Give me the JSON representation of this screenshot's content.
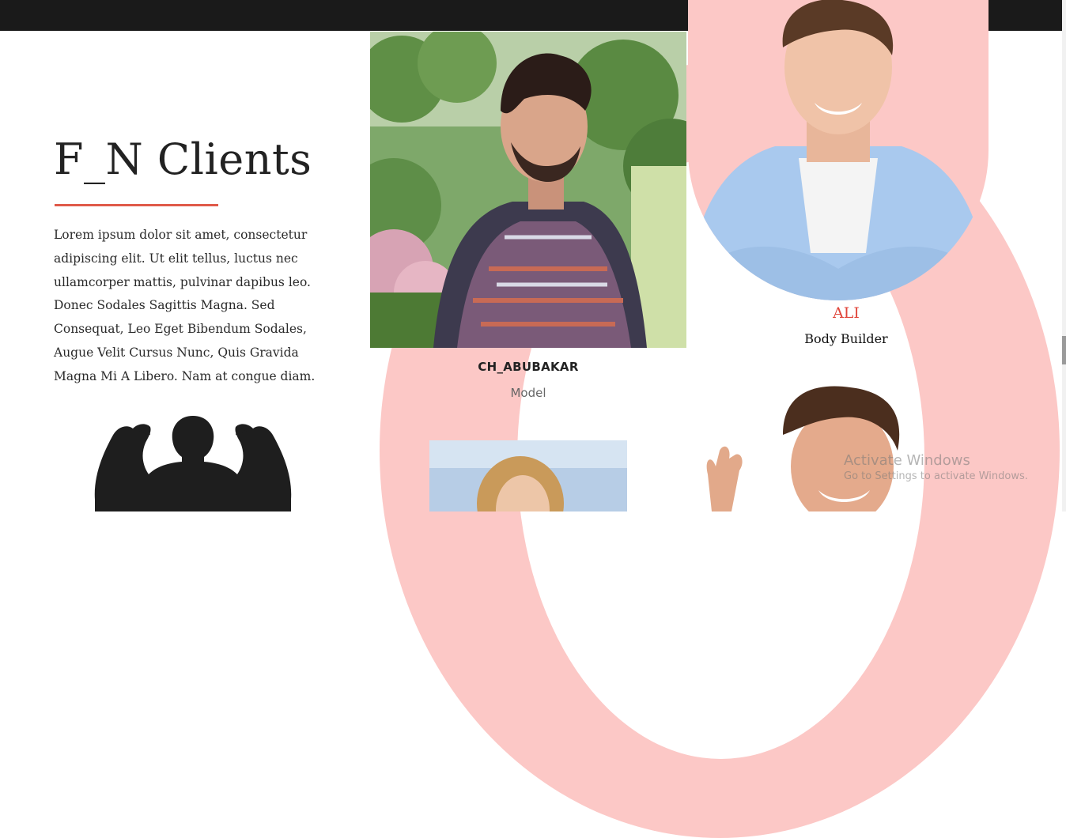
{
  "section": {
    "title": "F_N Clients",
    "description": "Lorem ipsum dolor sit amet, consectetur adipiscing elit. Ut elit tellus, luctus nec ullamcorper mattis, pulvinar dapibus leo. Donec Sodales Sagittis Magna. Sed Consequat, Leo Eget Bibendum Sodales, Augue Velit Cursus Nunc, Quis Gravida Magna Mi A Libero. Nam at congue diam.",
    "accent_color": "#e05a4a",
    "background_shape_color": "#fcc8c6"
  },
  "clients": [
    {
      "name": "CH_ABUBAKAR",
      "role": "Model"
    },
    {
      "name": "ALI",
      "role": "Body Builder"
    }
  ],
  "watermark": {
    "title": "Activate Windows",
    "subtitle": "Go to Settings to activate Windows."
  }
}
